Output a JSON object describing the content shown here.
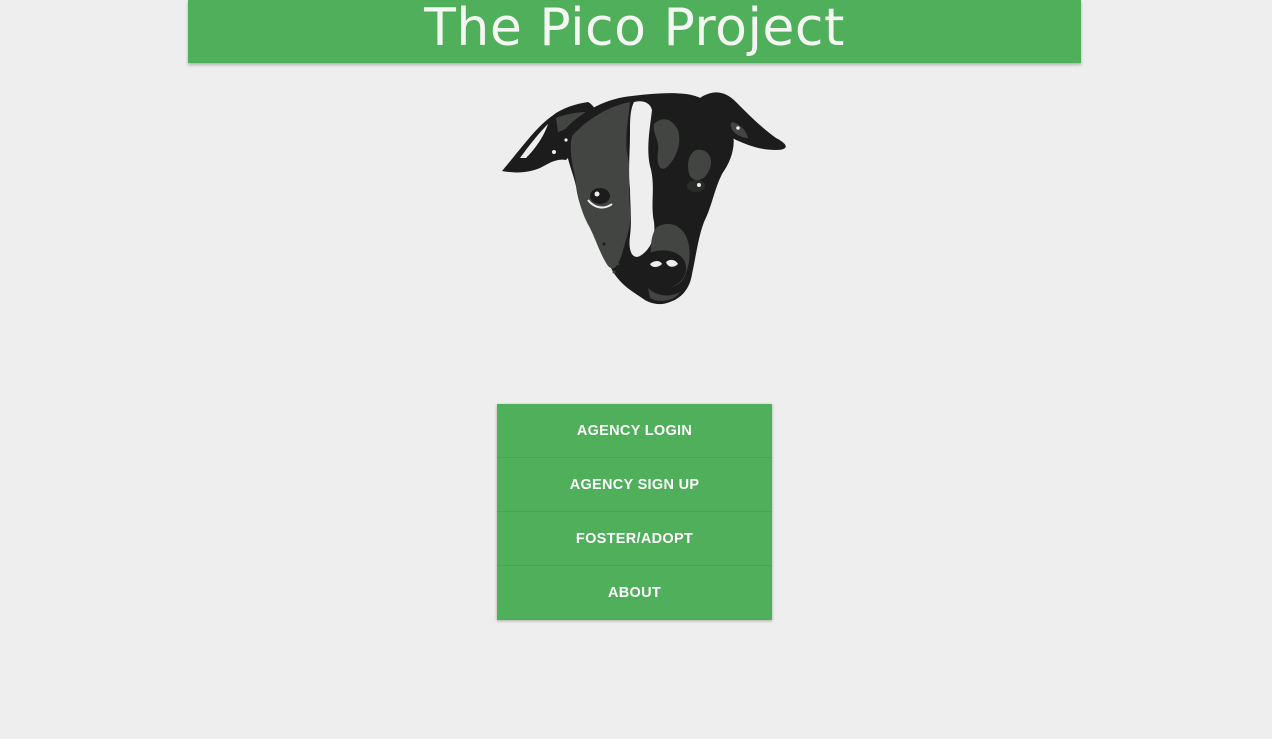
{
  "header": {
    "title": "The Pico Project"
  },
  "logo": {
    "icon": "dog-head-logo"
  },
  "menu": {
    "items": [
      {
        "label": "AGENCY LOGIN"
      },
      {
        "label": "AGENCY SIGN UP"
      },
      {
        "label": "FOSTER/ADOPT"
      },
      {
        "label": "ABOUT"
      }
    ]
  },
  "colors": {
    "background": "#eeeeee",
    "accent": "#4faf5a",
    "header_text": "#f4f6f2",
    "button_text": "#ffffff"
  }
}
